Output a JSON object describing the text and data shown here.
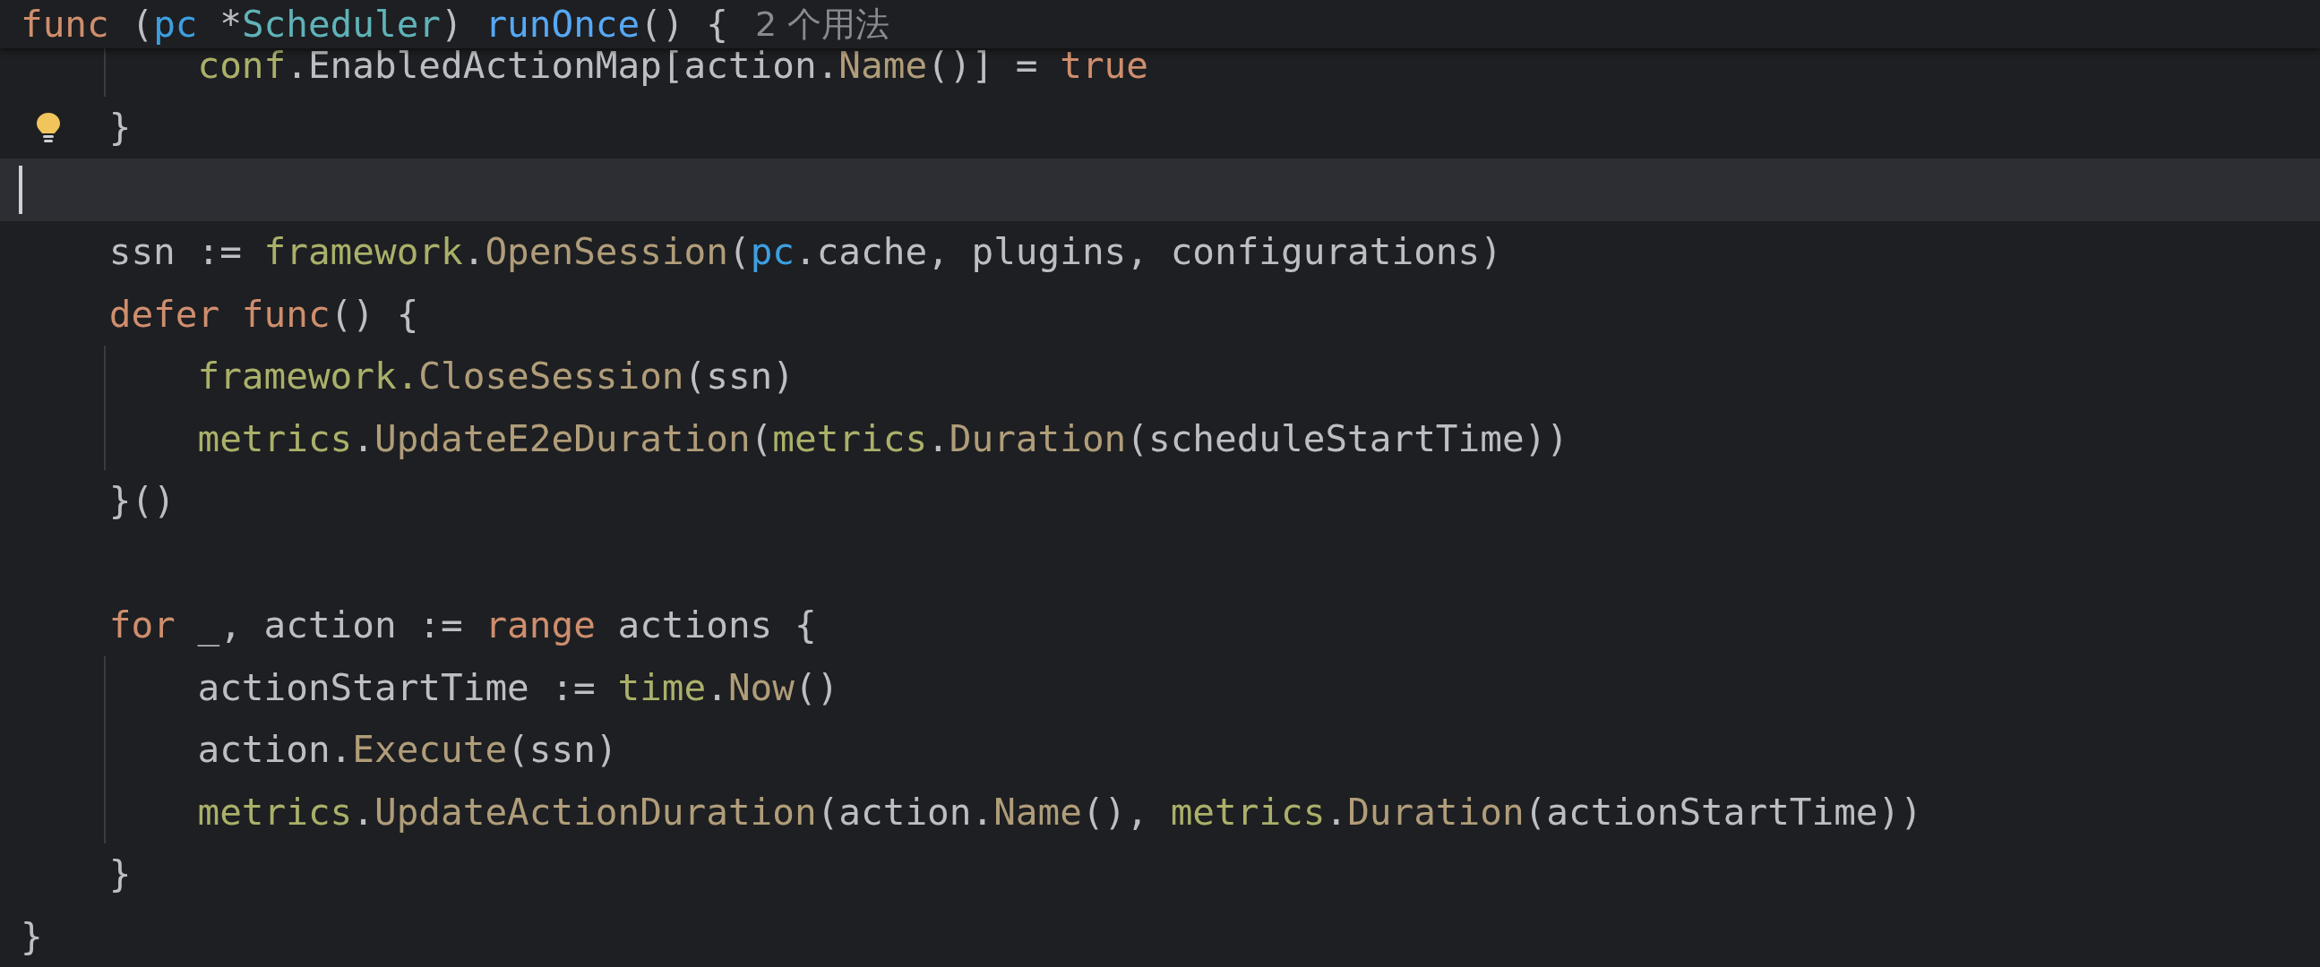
{
  "header": {
    "tokens": [
      {
        "kind": "keyword",
        "text": "func"
      },
      {
        "kind": "plain",
        "text": " ("
      },
      {
        "kind": "param",
        "text": "pc"
      },
      {
        "kind": "plain",
        "text": " *"
      },
      {
        "kind": "type",
        "text": "Scheduler"
      },
      {
        "kind": "plain",
        "text": ") "
      },
      {
        "kind": "decl",
        "text": "runOnce"
      },
      {
        "kind": "plain",
        "text": "() {"
      }
    ],
    "usages_hint": "2 个用法"
  },
  "lines": [
    {
      "current": false,
      "intention": false,
      "tokens": [
        {
          "kind": "pkg",
          "text": "        conf"
        },
        {
          "kind": "plain",
          "text": ".EnabledActionMap[action."
        },
        {
          "kind": "call",
          "text": "Name"
        },
        {
          "kind": "plain",
          "text": "()] = "
        },
        {
          "kind": "keyword",
          "text": "true"
        }
      ]
    },
    {
      "current": false,
      "intention": true,
      "tokens": [
        {
          "kind": "plain",
          "text": "    }"
        }
      ]
    },
    {
      "current": true,
      "intention": false
    },
    {
      "current": false,
      "intention": false,
      "tokens": [
        {
          "kind": "plain",
          "text": "    ssn := "
        },
        {
          "kind": "pkg",
          "text": "framework"
        },
        {
          "kind": "plain",
          "text": "."
        },
        {
          "kind": "call",
          "text": "OpenSession"
        },
        {
          "kind": "plain",
          "text": "("
        },
        {
          "kind": "param",
          "text": "pc"
        },
        {
          "kind": "plain",
          "text": ".cache, plugins, configurations)"
        }
      ]
    },
    {
      "current": false,
      "intention": false,
      "tokens": [
        {
          "kind": "keyword",
          "text": "    defer func"
        },
        {
          "kind": "plain",
          "text": "() {"
        }
      ]
    },
    {
      "current": false,
      "intention": false,
      "tokens": [
        {
          "kind": "pkg",
          "text": "        framework."
        },
        {
          "kind": "call",
          "text": "CloseSession"
        },
        {
          "kind": "plain",
          "text": "(ssn)"
        }
      ]
    },
    {
      "current": false,
      "intention": false,
      "tokens": [
        {
          "kind": "pkg",
          "text": "        metrics"
        },
        {
          "kind": "plain",
          "text": "."
        },
        {
          "kind": "call",
          "text": "UpdateE2eDuration"
        },
        {
          "kind": "plain",
          "text": "("
        },
        {
          "kind": "pkg",
          "text": "metrics"
        },
        {
          "kind": "plain",
          "text": "."
        },
        {
          "kind": "call",
          "text": "Duration"
        },
        {
          "kind": "plain",
          "text": "(scheduleStartTime))"
        }
      ]
    },
    {
      "current": false,
      "intention": false,
      "tokens": [
        {
          "kind": "plain",
          "text": "    }()"
        }
      ]
    },
    {
      "current": false,
      "intention": false
    },
    {
      "current": false,
      "intention": false,
      "tokens": [
        {
          "kind": "keyword",
          "text": "    for"
        },
        {
          "kind": "plain",
          "text": " _, action := "
        },
        {
          "kind": "keyword",
          "text": "range"
        },
        {
          "kind": "plain",
          "text": " actions {"
        }
      ]
    },
    {
      "current": false,
      "intention": false,
      "tokens": [
        {
          "kind": "plain",
          "text": "        actionStartTime := "
        },
        {
          "kind": "pkg",
          "text": "time"
        },
        {
          "kind": "plain",
          "text": "."
        },
        {
          "kind": "call",
          "text": "Now"
        },
        {
          "kind": "plain",
          "text": "()"
        }
      ]
    },
    {
      "current": false,
      "intention": false,
      "tokens": [
        {
          "kind": "plain",
          "text": "        action."
        },
        {
          "kind": "call",
          "text": "Execute"
        },
        {
          "kind": "plain",
          "text": "(ssn)"
        }
      ]
    },
    {
      "current": false,
      "intention": false,
      "tokens": [
        {
          "kind": "pkg",
          "text": "        metrics"
        },
        {
          "kind": "plain",
          "text": "."
        },
        {
          "kind": "call",
          "text": "UpdateActionDuration"
        },
        {
          "kind": "plain",
          "text": "(action."
        },
        {
          "kind": "call",
          "text": "Name"
        },
        {
          "kind": "plain",
          "text": "(), "
        },
        {
          "kind": "pkg",
          "text": "metrics"
        },
        {
          "kind": "plain",
          "text": "."
        },
        {
          "kind": "call",
          "text": "Duration"
        },
        {
          "kind": "plain",
          "text": "(actionStartTime))"
        }
      ]
    },
    {
      "current": false,
      "intention": false,
      "tokens": [
        {
          "kind": "plain",
          "text": "    }"
        }
      ]
    },
    {
      "current": false,
      "intention": false,
      "tokens": [
        {
          "kind": "plain",
          "text": "}"
        }
      ]
    }
  ]
}
